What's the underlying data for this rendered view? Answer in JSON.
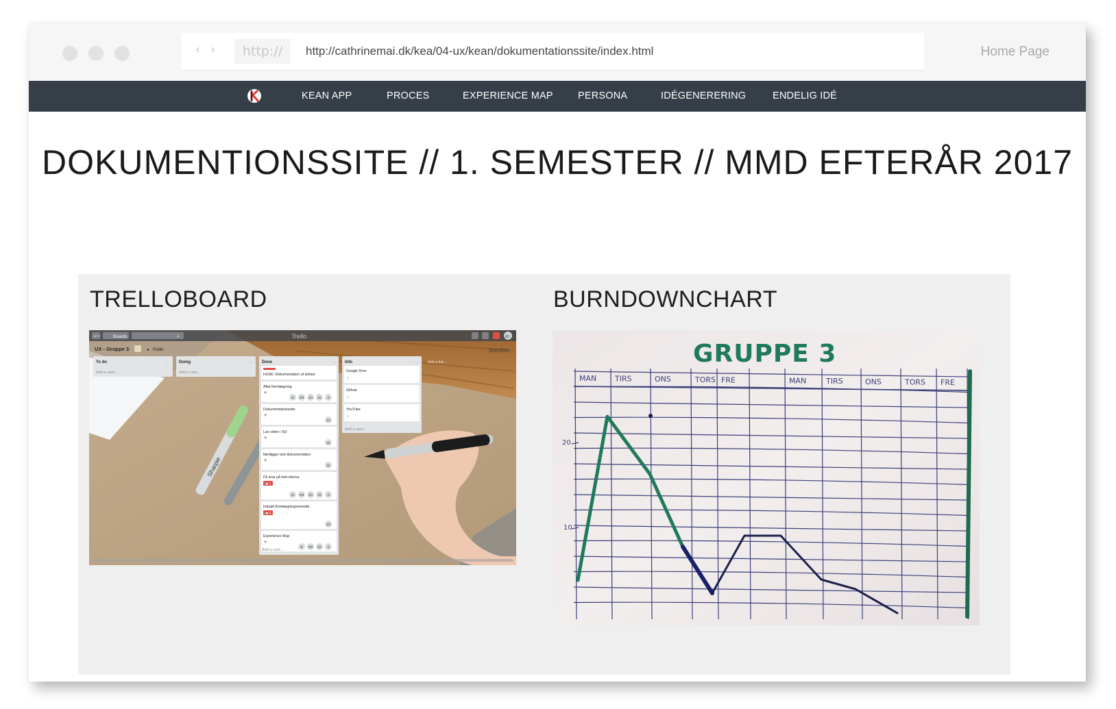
{
  "window": {
    "chrome_dot_count": 3
  },
  "address_bar": {
    "protocol_hint": "http://",
    "url": "http://cathrinemai.dk/kea/04-ux/kean/dokumentationssite/index.html",
    "label": "Home Page"
  },
  "nav": {
    "items": [
      {
        "label": "KEAN APP"
      },
      {
        "label": "PROCES"
      },
      {
        "label": "EXPERIENCE MAP"
      },
      {
        "label": "PERSONA"
      },
      {
        "label": "IDÉGENERERING"
      },
      {
        "label": "ENDELIG IDÉ"
      }
    ],
    "bar_color": "#363f48",
    "logo_accent": "#e03a3a"
  },
  "page": {
    "heading": "DOKUMENTIONSSITE // 1. SEMESTER // MMD EFTERÅR 2017"
  },
  "cards": [
    {
      "title": "TRELLOBOARD",
      "board": {
        "nav_boards": "Boards",
        "logo": "Trello",
        "name": "UX - Gruppe 3",
        "visibility": "Public",
        "show_menu": "Show Menu",
        "add_list": "Add a list...",
        "add_card": "Add a card...",
        "avatar": "JO",
        "lists": [
          {
            "name": "To do",
            "cards": []
          },
          {
            "name": "Doing",
            "cards": []
          },
          {
            "name": "Done",
            "cards": [
              {
                "text": "HUSK: Dokumentation af skitser",
                "members": []
              },
              {
                "text": "Aftal fremlægning",
                "members": [
                  "B",
                  "CR",
                  "JO",
                  "M",
                  "S"
                ]
              },
              {
                "text": "Dokumentationssite",
                "members": [
                  "JO"
                ]
              },
              {
                "text": "Lav video i XD",
                "members": [
                  "M"
                ]
              },
              {
                "text": "færdigger test-dokumentation",
                "members": [
                  "M"
                ]
              },
              {
                "text": "Få svar på test-skema",
                "badge": "1",
                "members": [
                  "B",
                  "CR",
                  "JO",
                  "M",
                  "S"
                ]
              },
              {
                "text": "Indsæt fremlægningsmetode",
                "badge": "4",
                "members": [
                  "JO"
                ]
              },
              {
                "text": "Experience Map",
                "members": [
                  "B",
                  "CR",
                  "JO",
                  "S"
                ]
              }
            ]
          },
          {
            "name": "Info",
            "cards": [
              {
                "text": "Google Drev"
              },
              {
                "text": "Github"
              },
              {
                "text": "YouTube"
              }
            ]
          }
        ]
      }
    },
    {
      "title": "BURNDOWNCHART",
      "photo": {
        "title": "GRUPPE 3",
        "days": [
          "MAN",
          "TIRS",
          "ONS",
          "TORS",
          "FRE",
          "",
          "MAN",
          "TIRS",
          "ONS",
          "TORS",
          "FRE"
        ],
        "y_tick_labels": [
          "20",
          "10"
        ],
        "green_color": "#1f7a5c",
        "ink_color": "#1a1f4a"
      }
    }
  ]
}
